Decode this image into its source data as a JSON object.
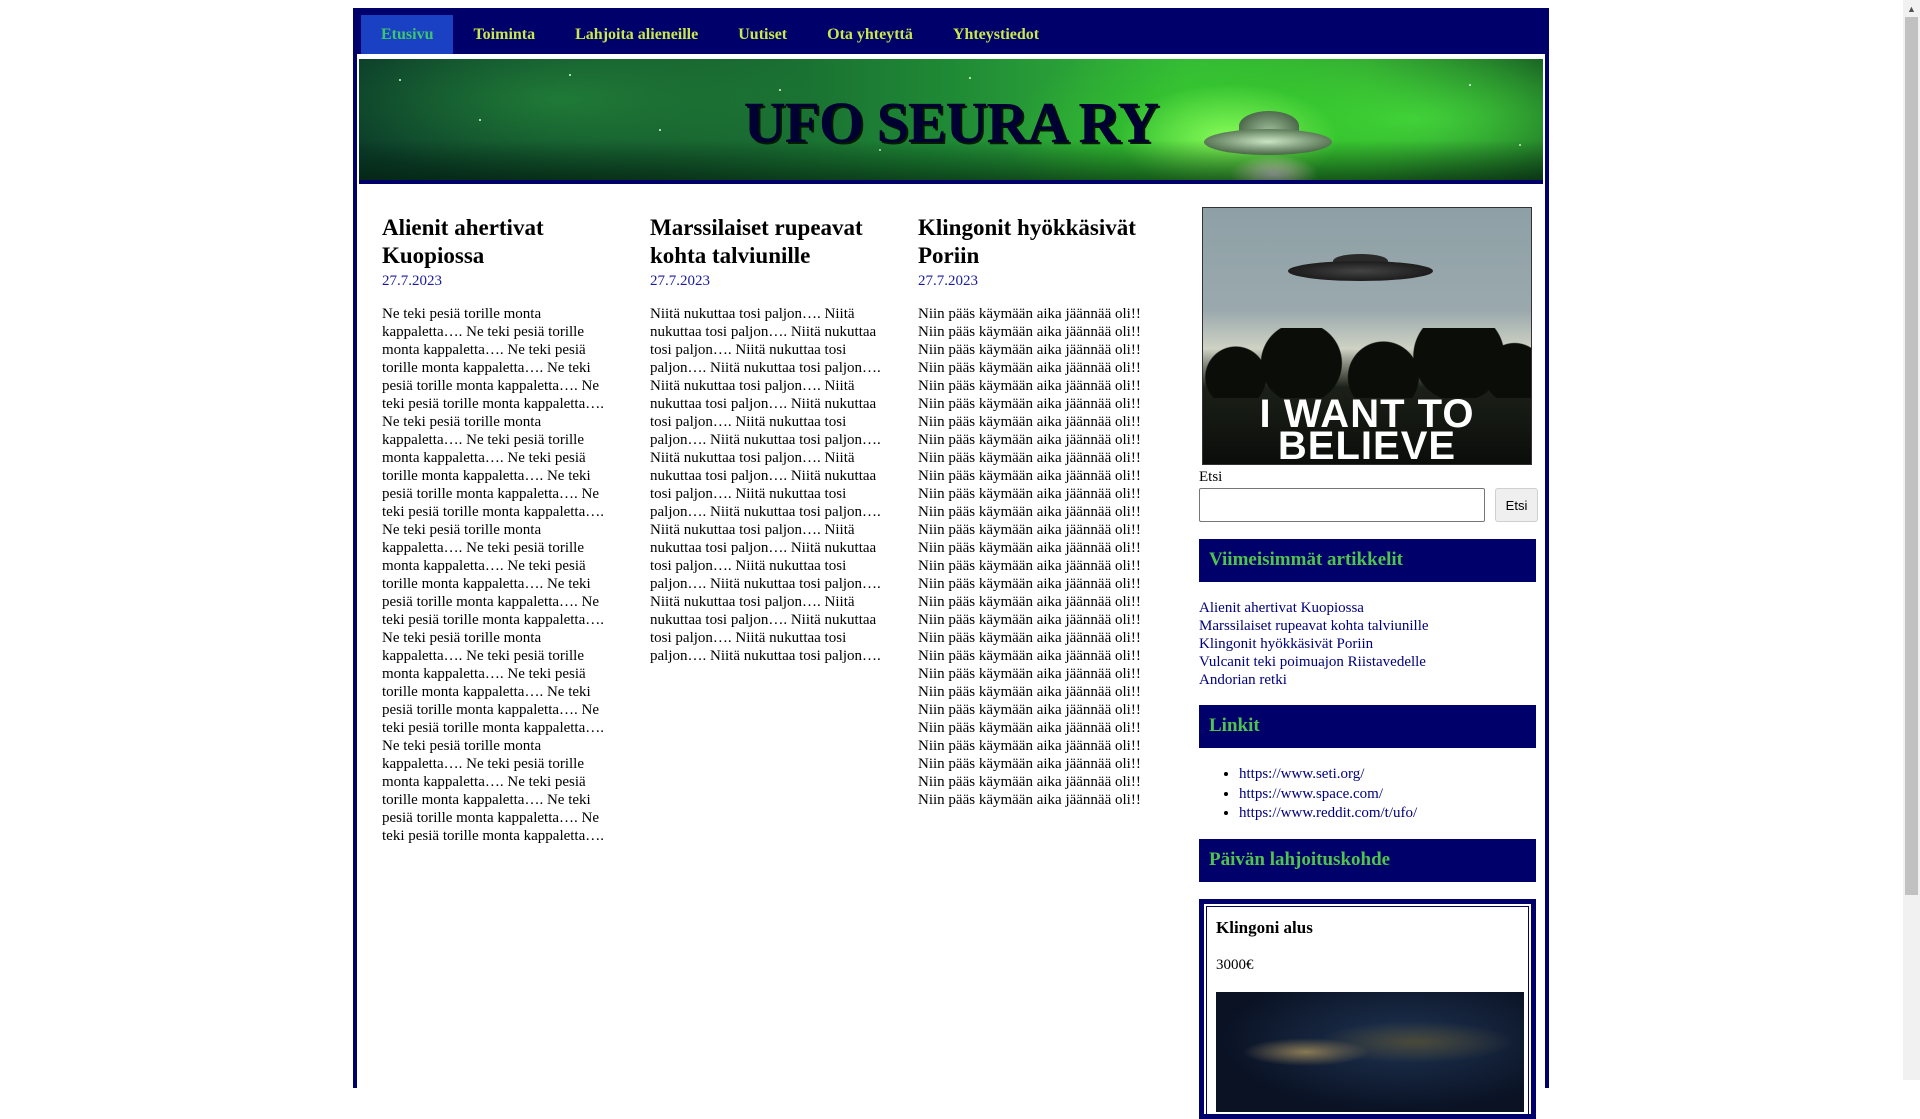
{
  "nav": {
    "items": [
      {
        "label": "Etusivu"
      },
      {
        "label": "Toiminta"
      },
      {
        "label": "Lahjoita alieneille"
      },
      {
        "label": "Uutiset"
      },
      {
        "label": "Ota yhteyttä"
      },
      {
        "label": "Yhteystiedot"
      }
    ],
    "active_index": 0
  },
  "banner": {
    "title": "UFO SEURA RY"
  },
  "articles": [
    {
      "title": "Alienit ahertivat Kuopiossa",
      "date": "27.7.2023",
      "body": "Ne teki pesiä torille monta kappaletta…. Ne teki pesiä torille monta kappaletta…. Ne teki pesiä torille monta kappaletta…. Ne teki pesiä torille monta kappaletta…. Ne teki pesiä torille monta kappaletta…. Ne teki pesiä torille monta kappaletta…. Ne teki pesiä torille monta kappaletta…. Ne teki pesiä torille monta kappaletta…. Ne teki pesiä torille monta kappaletta…. Ne teki pesiä torille monta kappaletta…. Ne teki pesiä torille monta kappaletta…. Ne teki pesiä torille monta kappaletta…. Ne teki pesiä torille monta kappaletta…. Ne teki pesiä torille monta kappaletta…. Ne teki pesiä torille monta kappaletta…. Ne teki pesiä torille monta kappaletta…. Ne teki pesiä torille monta kappaletta…. Ne teki pesiä torille monta kappaletta…. Ne teki pesiä torille monta kappaletta…. Ne teki pesiä torille monta kappaletta…. Ne teki pesiä torille monta kappaletta…. Ne teki pesiä torille monta kappaletta…. Ne teki pesiä torille monta kappaletta…. Ne teki pesiä torille monta kappaletta…. Ne teki pesiä torille monta kappaletta…."
    },
    {
      "title": "Marssilaiset rupeavat kohta talviunille",
      "date": "27.7.2023",
      "body": "Niitä nukuttaa tosi paljon…. Niitä nukuttaa tosi paljon…. Niitä nukuttaa tosi paljon…. Niitä nukuttaa tosi paljon…. Niitä nukuttaa tosi paljon…. Niitä nukuttaa tosi paljon…. Niitä nukuttaa tosi paljon…. Niitä nukuttaa tosi paljon…. Niitä nukuttaa tosi paljon…. Niitä nukuttaa tosi paljon…. Niitä nukuttaa tosi paljon…. Niitä nukuttaa tosi paljon…. Niitä nukuttaa tosi paljon…. Niitä nukuttaa tosi paljon…. Niitä nukuttaa tosi paljon…. Niitä nukuttaa tosi paljon…. Niitä nukuttaa tosi paljon…. Niitä nukuttaa tosi paljon…. Niitä nukuttaa tosi paljon…. Niitä nukuttaa tosi paljon…. Niitä nukuttaa tosi paljon…. Niitä nukuttaa tosi paljon…. Niitä nukuttaa tosi paljon…. Niitä nukuttaa tosi paljon…. Niitä nukuttaa tosi paljon…."
    },
    {
      "title": "Klingonit hyökkäsivät Poriin",
      "date": "27.7.2023",
      "body": "Niin pääs käymään aika jäännää oli!! Niin pääs käymään aika jäännää oli!! Niin pääs käymään aika jäännää oli!! Niin pääs käymään aika jäännää oli!! Niin pääs käymään aika jäännää oli!! Niin pääs käymään aika jäännää oli!! Niin pääs käymään aika jäännää oli!! Niin pääs käymään aika jäännää oli!! Niin pääs käymään aika jäännää oli!! Niin pääs käymään aika jäännää oli!! Niin pääs käymään aika jäännää oli!! Niin pääs käymään aika jäännää oli!! Niin pääs käymään aika jäännää oli!! Niin pääs käymään aika jäännää oli!! Niin pääs käymään aika jäännää oli!! Niin pääs käymään aika jäännää oli!! Niin pääs käymään aika jäännää oli!! Niin pääs käymään aika jäännää oli!! Niin pääs käymään aika jäännää oli!! Niin pääs käymään aika jäännää oli!! Niin pääs käymään aika jäännää oli!! Niin pääs käymään aika jäännää oli!! Niin pääs käymään aika jäännää oli!! Niin pääs käymään aika jäännää oli!! Niin pääs käymään aika jäännää oli!! Niin pääs käymään aika jäännää oli!! Niin pääs käymään aika jäännää oli!! Niin pääs käymään aika jäännää oli!!"
    }
  ],
  "sidebar": {
    "poster_text_line1": "I WANT TO",
    "poster_text_line2": "BELIEVE",
    "search": {
      "label": "Etsi",
      "button": "Etsi",
      "value": "",
      "placeholder": ""
    },
    "recent": {
      "title": "Viimeisimmät artikkelit",
      "items": [
        "Alienit ahertivat Kuopiossa",
        "Marssilaiset rupeavat kohta talviunille",
        "Klingonit hyökkäsivät Poriin",
        "Vulcanit teki poimuajon Riistavedelle",
        "Andorian retki"
      ]
    },
    "links": {
      "title": "Linkit",
      "items": [
        "https://www.seti.org/",
        "https://www.space.com/",
        "https://www.reddit.com/t/ufo/"
      ]
    },
    "donation": {
      "title": "Päivän lahjoituskohde",
      "item_title": "Klingoni alus",
      "price": "3000€"
    }
  },
  "colors": {
    "navy": "#00006b",
    "nav_text": "#c9e84a",
    "active_tab": "#1a40c4",
    "widget_title": "#4ec44e",
    "link": "#00007a"
  },
  "icons": {
    "search_button": "none",
    "scroll_up": "triangle-up-icon"
  }
}
